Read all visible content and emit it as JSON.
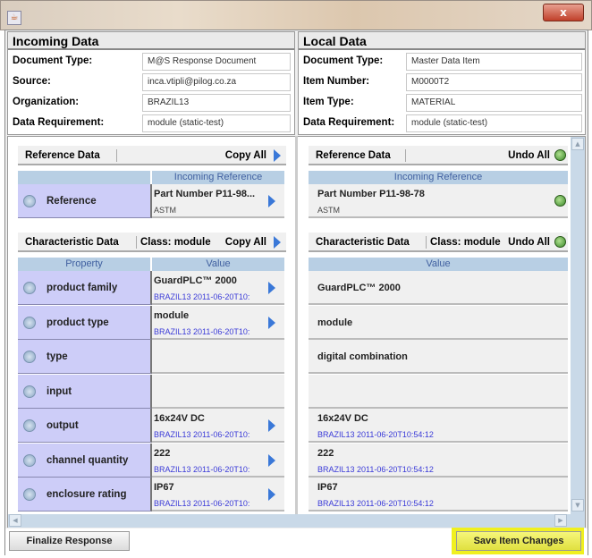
{
  "window": {
    "close_label": "x",
    "app_icon": "java-icon"
  },
  "incoming": {
    "title": "Incoming Data",
    "fields": [
      {
        "label": "Document Type:",
        "value": "M@S Response Document"
      },
      {
        "label": "Source:",
        "value": "inca.vtipli@pilog.co.za"
      },
      {
        "label": "Organization:",
        "value": "BRAZIL13"
      },
      {
        "label": "Data Requirement:",
        "value": "module (static-test)"
      }
    ],
    "reference_section": {
      "title": "Reference Data",
      "action": "Copy All",
      "column": "Incoming Reference",
      "property": "Reference",
      "value": "Part Number P11-98...",
      "sub": "ASTM"
    },
    "characteristic_section": {
      "title": "Characteristic Data",
      "class_label": "Class: module",
      "action": "Copy All",
      "col_property": "Property",
      "col_value": "Value"
    },
    "rows": [
      {
        "property": "product family",
        "value": "GuardPLC™ 2000",
        "sub": "BRAZIL13 2011-06-20T10:"
      },
      {
        "property": "product type",
        "value": "module",
        "sub": "BRAZIL13 2011-06-20T10:"
      },
      {
        "property": "type",
        "value": "",
        "sub": ""
      },
      {
        "property": "input",
        "value": "",
        "sub": ""
      },
      {
        "property": "output",
        "value": "16x24V DC",
        "sub": "BRAZIL13 2011-06-20T10:"
      },
      {
        "property": "channel quantity",
        "value": "222",
        "sub": "BRAZIL13 2011-06-20T10:"
      },
      {
        "property": "enclosure rating",
        "value": "IP67",
        "sub": "BRAZIL13 2011-06-20T10:"
      }
    ]
  },
  "local": {
    "title": "Local Data",
    "fields": [
      {
        "label": "Document Type:",
        "value": "Master Data Item"
      },
      {
        "label": "Item Number:",
        "value": "M0000T2"
      },
      {
        "label": "Item Type:",
        "value": "MATERIAL"
      },
      {
        "label": "Data Requirement:",
        "value": "module (static-test)"
      }
    ],
    "reference_section": {
      "title": "Reference Data",
      "action": "Undo All",
      "column": "Incoming Reference",
      "value": "Part Number P11-98-78",
      "sub": "ASTM"
    },
    "characteristic_section": {
      "title": "Characteristic Data",
      "class_label": "Class: module",
      "action": "Undo All",
      "col_value": "Value"
    },
    "rows": [
      {
        "value": "GuardPLC™ 2000",
        "sub": ""
      },
      {
        "value": "module",
        "sub": ""
      },
      {
        "value": "digital combination",
        "sub": ""
      },
      {
        "value": "",
        "sub": ""
      },
      {
        "value": "16x24V DC",
        "sub": "BRAZIL13 2011-06-20T10:54:12"
      },
      {
        "value": "222",
        "sub": "BRAZIL13 2011-06-20T10:54:12"
      },
      {
        "value": "IP67",
        "sub": "BRAZIL13 2011-06-20T10:54:12"
      }
    ]
  },
  "footer": {
    "finalize_label": "Finalize Response",
    "save_label": "Save Item Changes",
    "highlight_color": "#f0f020"
  }
}
